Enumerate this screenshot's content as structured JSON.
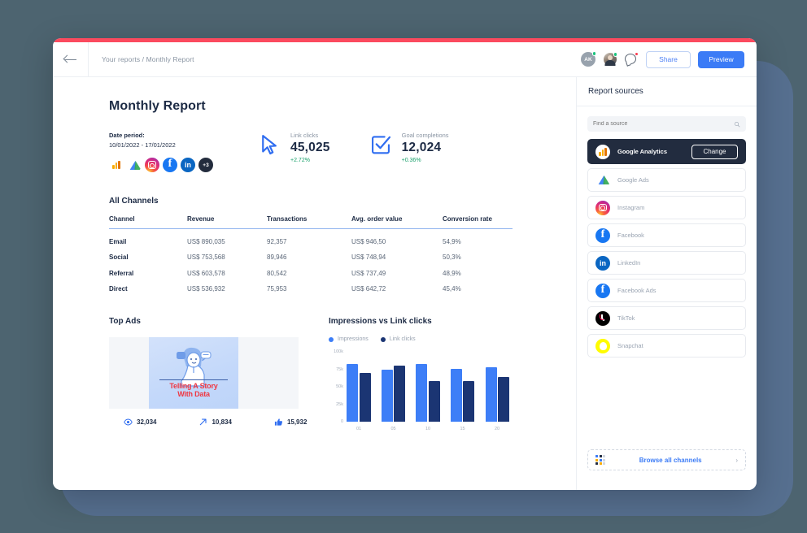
{
  "window": {
    "breadcrumb": "Your reports / Monthly Report",
    "back_icon": "back-arrow-icon"
  },
  "topbar": {
    "avatar_initials": "AK",
    "share_label": "Share",
    "preview_label": "Preview"
  },
  "report": {
    "title": "Monthly Report",
    "date_label": "Date period:",
    "date_value": "10/01/2022 - 17/01/2022",
    "source_icons": [
      "google-analytics",
      "google-ads",
      "instagram",
      "facebook",
      "linkedin",
      "+3"
    ],
    "more_badge": "+3"
  },
  "metrics": [
    {
      "label": "Link clicks",
      "value": "45,025",
      "delta": "+2.72%",
      "icon": "cursor-icon"
    },
    {
      "label": "Goal completions",
      "value": "12,024",
      "delta": "+0.36%",
      "icon": "checkbox-icon"
    }
  ],
  "channels": {
    "title": "All Channels",
    "columns": [
      "Channel",
      "Revenue",
      "Transactions",
      "Avg. order value",
      "Conversion rate"
    ],
    "rows": [
      [
        "Email",
        "US$ 890,035",
        "92,357",
        "US$ 946,50",
        "54,9%"
      ],
      [
        "Social",
        "US$ 753,568",
        "89,946",
        "US$ 748,94",
        "50,3%"
      ],
      [
        "Referral",
        "US$ 603,578",
        "80,542",
        "US$ 737,49",
        "48,9%"
      ],
      [
        "Direct",
        "US$ 536,932",
        "75,953",
        "US$ 642,72",
        "45,4%"
      ]
    ]
  },
  "top_ads": {
    "title": "Top Ads",
    "ad_text_line1": "Telling A Story",
    "ad_text_line2": "With Data",
    "stats": [
      {
        "icon": "eye-icon",
        "value": "32,034"
      },
      {
        "icon": "arrow-up-right-icon",
        "value": "10,834"
      },
      {
        "icon": "thumbs-up-icon",
        "value": "15,932"
      }
    ]
  },
  "chart_data": {
    "type": "bar",
    "title": "Impressions vs Link clicks",
    "categories": [
      "01",
      "05",
      "10",
      "15",
      "20"
    ],
    "series": [
      {
        "name": "Impressions",
        "values": [
          82000,
          74000,
          82000,
          76000,
          78000
        ],
        "color": "#3d7ef7"
      },
      {
        "name": "Link clicks",
        "values": [
          70000,
          80000,
          58000,
          58000,
          64000
        ],
        "color": "#1b3573"
      }
    ],
    "ylabel": "",
    "xlabel": "",
    "ylim": [
      0,
      100000
    ],
    "yticks": [
      "100k",
      "75k",
      "50k",
      "25k",
      "0"
    ],
    "grid": false,
    "legend_position": "top-left"
  },
  "panel": {
    "title": "Report sources",
    "search_placeholder": "Find a source",
    "change_label": "Change",
    "sources": [
      {
        "name": "Google Analytics",
        "icon": "google-analytics-icon",
        "active": true
      },
      {
        "name": "Google Ads",
        "icon": "google-ads-icon",
        "active": false
      },
      {
        "name": "Instagram",
        "icon": "instagram-icon",
        "active": false
      },
      {
        "name": "Facebook",
        "icon": "facebook-icon",
        "active": false
      },
      {
        "name": "LinkedIn",
        "icon": "linkedin-icon",
        "active": false
      },
      {
        "name": "Facebook Ads",
        "icon": "facebook-ads-icon",
        "active": false
      },
      {
        "name": "TikTok",
        "icon": "tiktok-icon",
        "active": false
      },
      {
        "name": "Snapchat",
        "icon": "snapchat-icon",
        "active": false
      }
    ],
    "browse_label": "Browse all channels",
    "browse_chevron": "›"
  },
  "theme": {
    "accent_red": "#fb4a5e",
    "primary_blue": "#3b7bf6",
    "dark_navy": "#222c3f",
    "green": "#19a06b",
    "background": "#4d6470",
    "deco": "#566f8f"
  }
}
